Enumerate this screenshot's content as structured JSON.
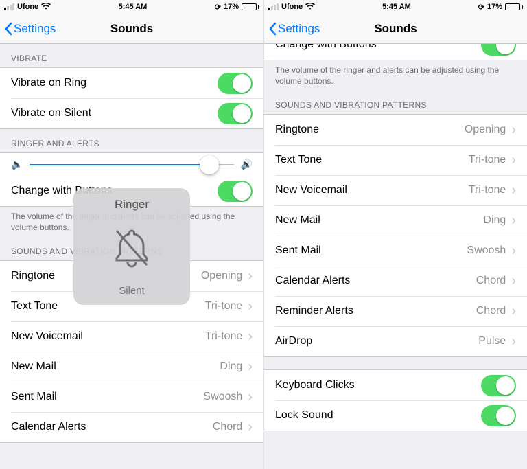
{
  "status": {
    "carrier": "Ufone",
    "time": "5:45 AM",
    "battery_pct": "17%",
    "battery_fill": 17
  },
  "nav": {
    "back": "Settings",
    "title": "Sounds"
  },
  "left": {
    "vibrate_header": "VIBRATE",
    "vibrate_ring": "Vibrate on Ring",
    "vibrate_silent": "Vibrate on Silent",
    "ringer_header": "RINGER AND ALERTS",
    "slider_pct": 88,
    "change_buttons": "Change with Buttons",
    "footer": "The volume of the ringer and alerts can be adjusted using the volume buttons.",
    "patterns_header": "SOUNDS AND VIBRATION PATTERNS",
    "rows": [
      {
        "label": "Ringtone",
        "value": "Opening"
      },
      {
        "label": "Text Tone",
        "value": "Tri-tone"
      },
      {
        "label": "New Voicemail",
        "value": "Tri-tone"
      },
      {
        "label": "New Mail",
        "value": "Ding"
      },
      {
        "label": "Sent Mail",
        "value": "Swoosh"
      },
      {
        "label": "Calendar Alerts",
        "value": "Chord"
      }
    ],
    "hud_title": "Ringer",
    "hud_sub": "Silent"
  },
  "right": {
    "change_buttons": "Change with Buttons",
    "footer": "The volume of the ringer and alerts can be adjusted using the volume buttons.",
    "patterns_header": "SOUNDS AND VIBRATION PATTERNS",
    "rows": [
      {
        "label": "Ringtone",
        "value": "Opening"
      },
      {
        "label": "Text Tone",
        "value": "Tri-tone"
      },
      {
        "label": "New Voicemail",
        "value": "Tri-tone"
      },
      {
        "label": "New Mail",
        "value": "Ding"
      },
      {
        "label": "Sent Mail",
        "value": "Swoosh"
      },
      {
        "label": "Calendar Alerts",
        "value": "Chord"
      },
      {
        "label": "Reminder Alerts",
        "value": "Chord"
      },
      {
        "label": "AirDrop",
        "value": "Pulse"
      }
    ],
    "keyboard_clicks": "Keyboard Clicks",
    "lock_sound": "Lock Sound"
  }
}
